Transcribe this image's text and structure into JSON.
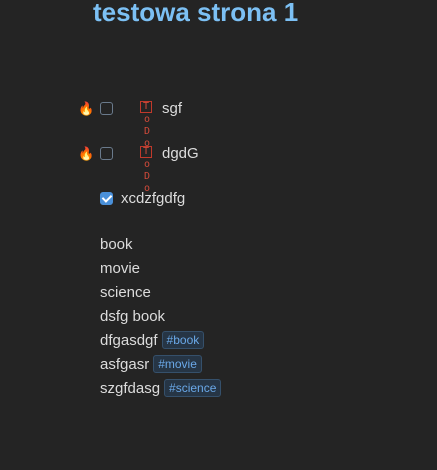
{
  "page": {
    "title": "testowa strona 1"
  },
  "tasks": [
    {
      "icon": "fire-icon",
      "checked": false,
      "marker": [
        "T",
        "o",
        "D",
        "o"
      ],
      "text": "sgf"
    },
    {
      "icon": "fire-icon",
      "checked": false,
      "marker": [
        "T",
        "o",
        "D",
        "o"
      ],
      "text": "dgdG"
    },
    {
      "checked": true,
      "text": "xcdzfgdfg"
    }
  ],
  "list": [
    {
      "text": "book"
    },
    {
      "text": "movie"
    },
    {
      "text": "science"
    },
    {
      "text": "dsfg book"
    },
    {
      "text": "dfgasdgf",
      "tag": "#book"
    },
    {
      "text": "asfgasr",
      "tag": "#movie"
    },
    {
      "text": "szgfdasg",
      "tag": "#science"
    }
  ],
  "colors": {
    "background": "#242424",
    "title": "#7cc0f4",
    "tag_text": "#6aa8e8",
    "marker": "#d04a3a",
    "checkbox_checked": "#4a90d9"
  }
}
